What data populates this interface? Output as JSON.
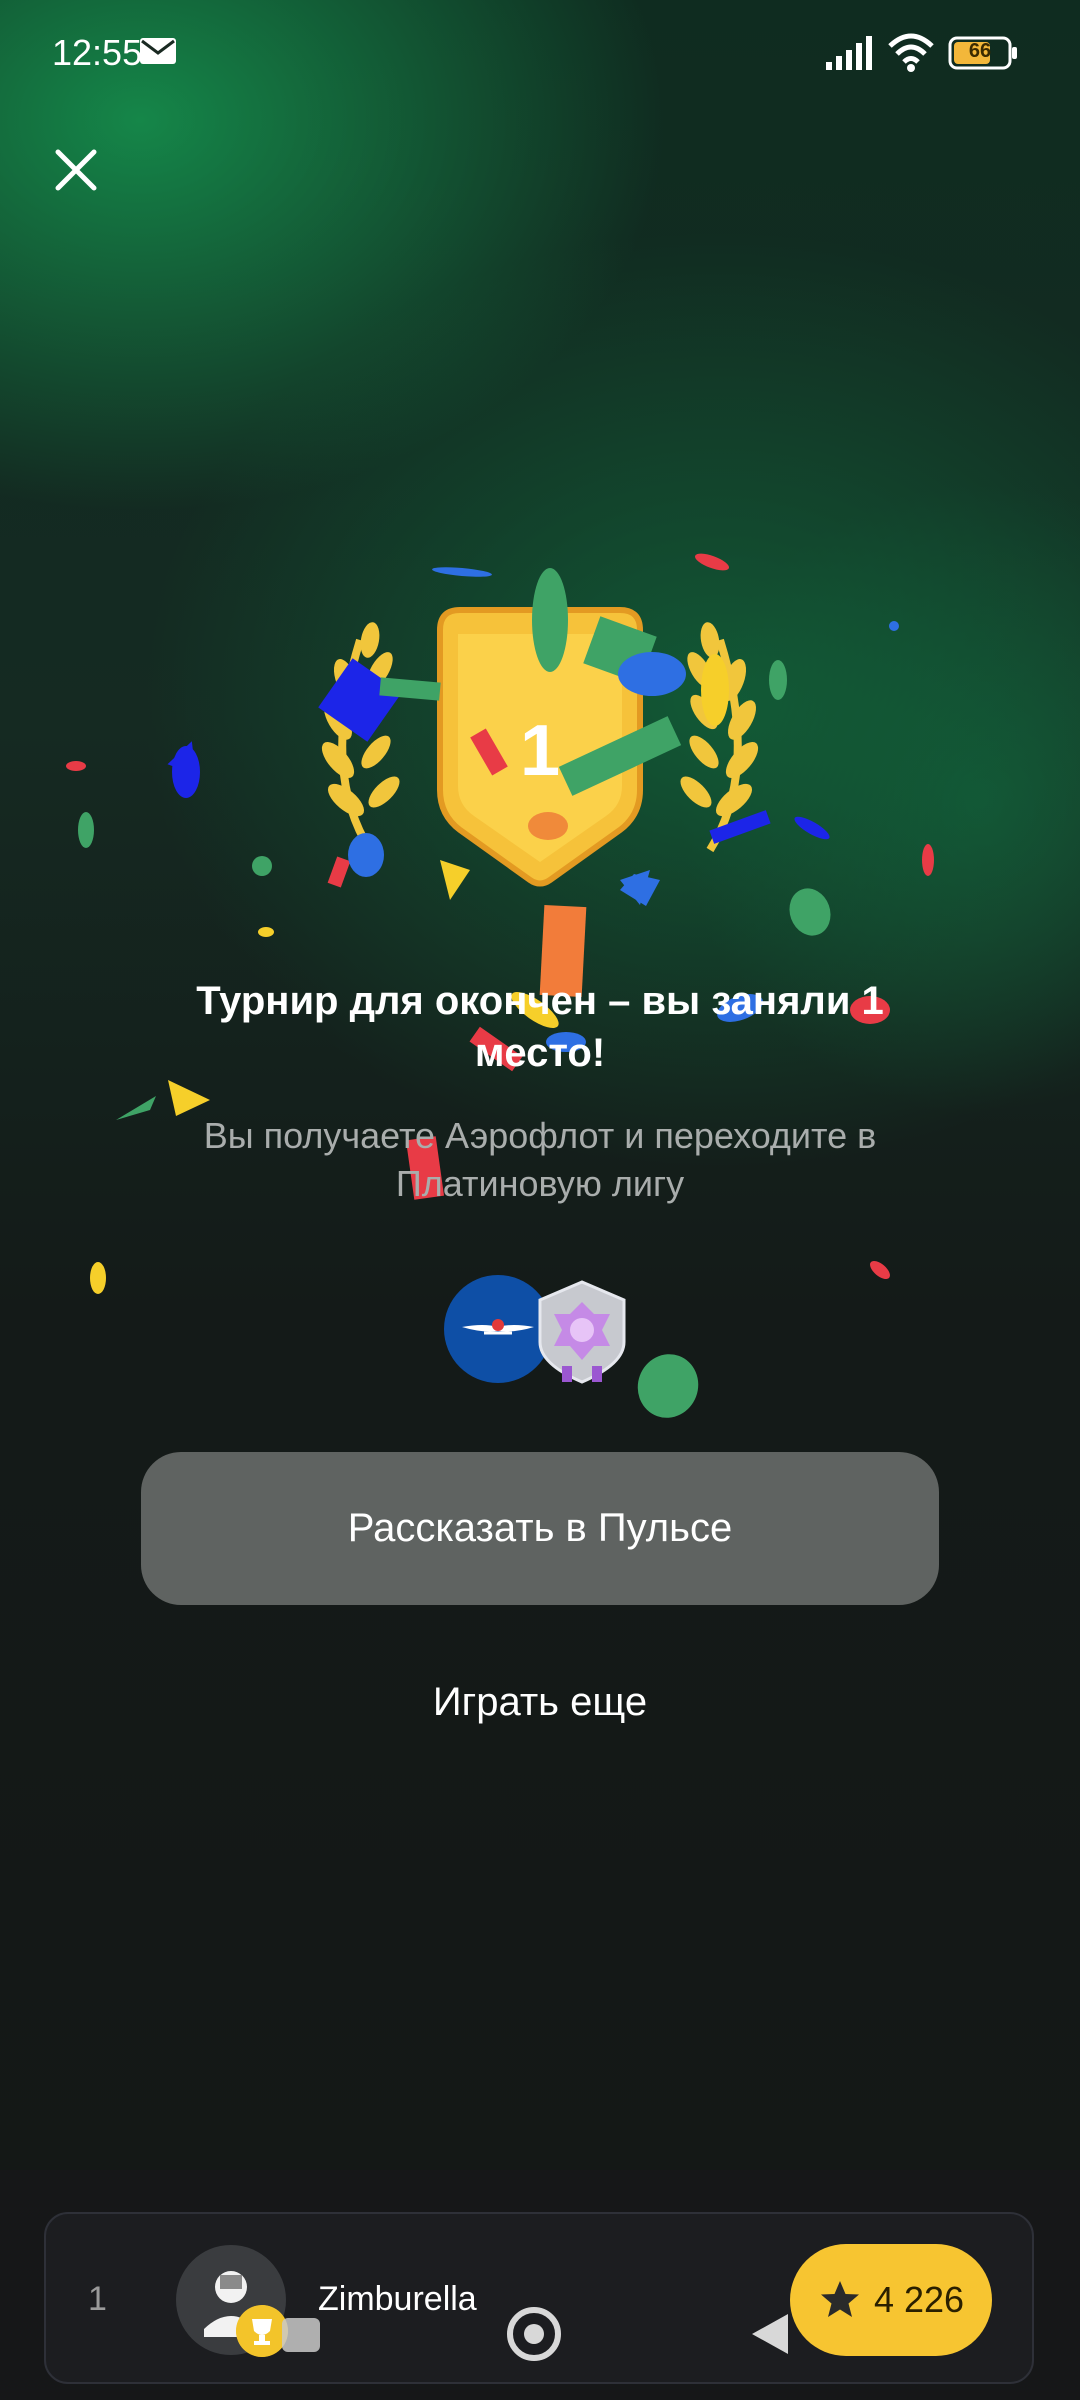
{
  "status_bar": {
    "time": "12:55",
    "battery": "66",
    "icons": [
      "mail-icon",
      "signal-icon",
      "wifi-icon",
      "battery-icon"
    ]
  },
  "header": {
    "close_icon": "close-icon"
  },
  "result": {
    "place_number": "1",
    "title": "Турнир для окончен – вы заняли 1 место!",
    "subtitle": "Вы получаете Аэрофлот и переходите в Платиновую лигу"
  },
  "actions": {
    "share_label": "Рассказать в Пульсе",
    "play_again_label": "Играть еще"
  },
  "leaderboard": {
    "rank": "1",
    "username": "Zimburella",
    "score": "4 226"
  },
  "colors": {
    "accent_yellow": "#f7c531",
    "button_gray": "#5f6361",
    "background": "#141716",
    "glow_green": "#16964f"
  }
}
